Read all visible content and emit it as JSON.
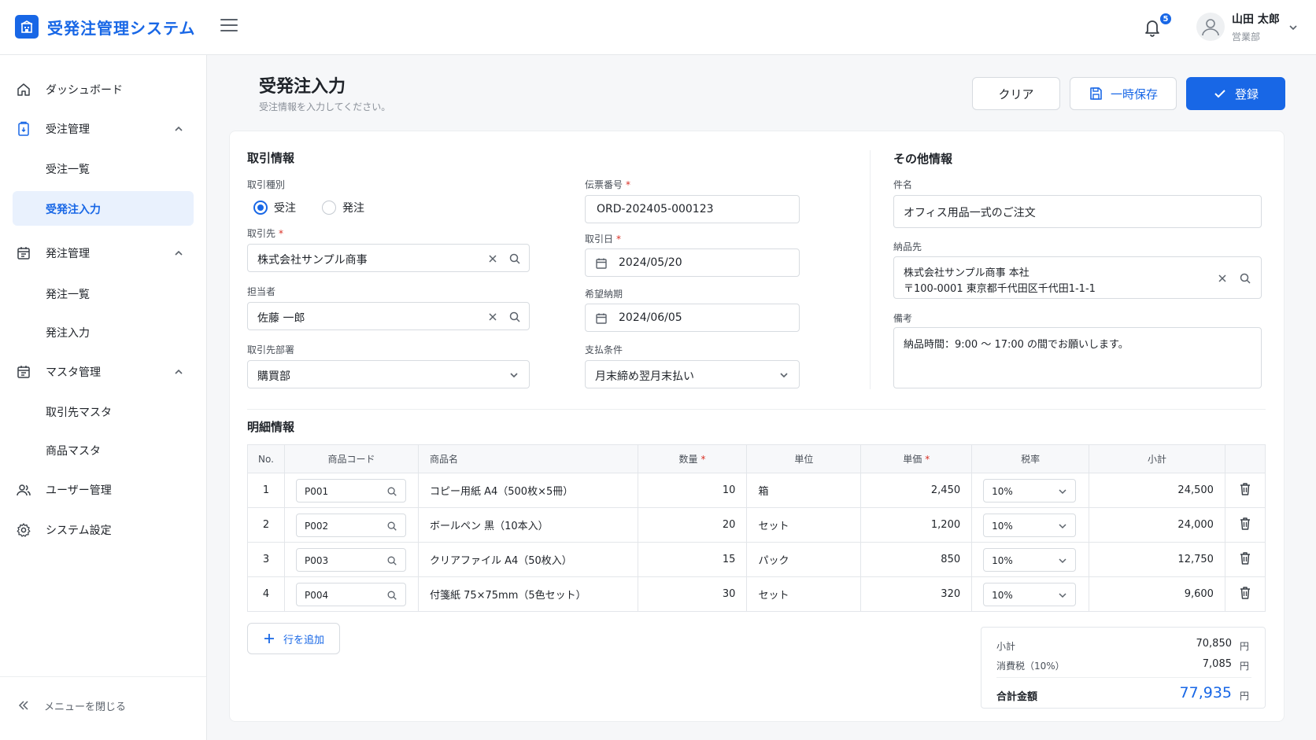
{
  "app": {
    "title": "受発注管理システム"
  },
  "header": {
    "notification_count": "5",
    "user_name": "山田 太郎",
    "user_dept": "営業部"
  },
  "sidebar": {
    "items": [
      {
        "label": "ダッシュボード"
      },
      {
        "label": "受注管理",
        "children": [
          "受注一覧",
          "受発注入力"
        ]
      },
      {
        "label": "発注管理",
        "children": [
          "発注一覧",
          "発注入力"
        ]
      },
      {
        "label": "マスタ管理",
        "children": [
          "取引先マスタ",
          "商品マスタ"
        ]
      },
      {
        "label": "ユーザー管理"
      },
      {
        "label": "システム設定"
      }
    ],
    "collapse_label": "メニューを閉じる"
  },
  "page": {
    "title": "受発注入力",
    "subtitle": "受注情報を入力してください。",
    "buttons": {
      "clear": "クリア",
      "save": "一時保存",
      "register": "登録"
    }
  },
  "transaction": {
    "section_title": "取引情報",
    "type_label": "取引種別",
    "type_options": [
      "受注",
      "発注"
    ],
    "type_selected": "受注",
    "customer_label": "取引先",
    "customer_value": "株式会社サンプル商事",
    "person_label": "担当者",
    "person_value": "佐藤 一郎",
    "dept_label": "取引先部署",
    "dept_value": "購買部",
    "slip_label": "伝票番号",
    "slip_value": "ORD-202405-000123",
    "date_label": "取引日",
    "date_value": "2024/05/20",
    "delivery_label": "希望納期",
    "delivery_value": "2024/06/05",
    "payment_label": "支払条件",
    "payment_value": "月末締め翌月末払い"
  },
  "other": {
    "section_title": "その他情報",
    "subject_label": "件名",
    "subject_value": "オフィス用品一式のご注文",
    "ship_label": "納品先",
    "ship_line1": "株式会社サンプル商事 本社",
    "ship_line2": "〒100-0001 東京都千代田区千代田1-1-1",
    "memo_label": "備考",
    "memo_value": "納品時間：9:00 〜 17:00 の間でお願いします。"
  },
  "details": {
    "section_title": "明細情報",
    "columns": [
      "No.",
      "商品コード",
      "商品名",
      "数量",
      "単位",
      "単価",
      "税率",
      "小計"
    ],
    "rows": [
      {
        "no": "1",
        "code": "P001",
        "name": "コピー用紙 A4（500枚×5冊）",
        "qty": "10",
        "unit": "箱",
        "price": "2,450",
        "tax": "10%",
        "subtotal": "24,500"
      },
      {
        "no": "2",
        "code": "P002",
        "name": "ボールペン 黒（10本入）",
        "qty": "20",
        "unit": "セット",
        "price": "1,200",
        "tax": "10%",
        "subtotal": "24,000"
      },
      {
        "no": "3",
        "code": "P003",
        "name": "クリアファイル A4（50枚入）",
        "qty": "15",
        "unit": "パック",
        "price": "850",
        "tax": "10%",
        "subtotal": "12,750"
      },
      {
        "no": "4",
        "code": "P004",
        "name": "付箋紙 75×75mm（5色セット）",
        "qty": "30",
        "unit": "セット",
        "price": "320",
        "tax": "10%",
        "subtotal": "9,600"
      }
    ],
    "add_row_label": "行を追加"
  },
  "summary": {
    "subtotal_label": "小計",
    "subtotal_value": "70,850",
    "tax_label": "消費税（10%）",
    "tax_value": "7,085",
    "total_label": "合計金額",
    "total_value": "77,935",
    "yen": "円"
  },
  "colors": {
    "accent": "#1867e6",
    "required": "#d93025"
  }
}
